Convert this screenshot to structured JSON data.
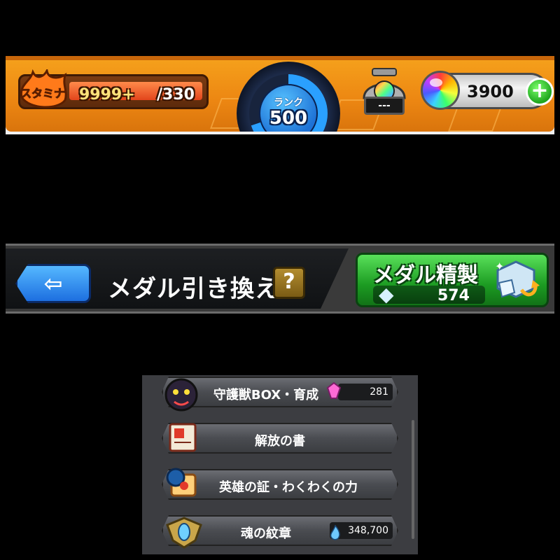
{
  "top_bar": {
    "stamina_badge": "スタミナ",
    "stamina_value": "9999+",
    "stamina_max": "/330",
    "rank_label": "ランク",
    "rank_value": "500",
    "egg_display": "---",
    "orb_count": "3900",
    "plus_icon": "plus-icon",
    "colors": {
      "bar": "#ec8612",
      "rank_ring": "#2aa0ff",
      "plus": "#1ea51e"
    }
  },
  "header": {
    "back_icon": "back-arrow-icon",
    "title": "メダル引き換え",
    "help_label": "?",
    "craft_label": "メダル精製",
    "craft_count": "574"
  },
  "menu": {
    "items": [
      {
        "label": "守護獣BOX・育成",
        "badge": "281",
        "icon": "guardian-beast-icon",
        "badge_icon": "pink-crystal-icon"
      },
      {
        "label": "解放の書",
        "icon": "scroll-book-icon"
      },
      {
        "label": "英雄の証・わくわくの力",
        "icon": "hero-proof-icon"
      },
      {
        "label": "魂の紋章",
        "badge": "348,700",
        "icon": "soul-crest-icon",
        "badge_icon": "blue-flame-icon"
      }
    ]
  }
}
